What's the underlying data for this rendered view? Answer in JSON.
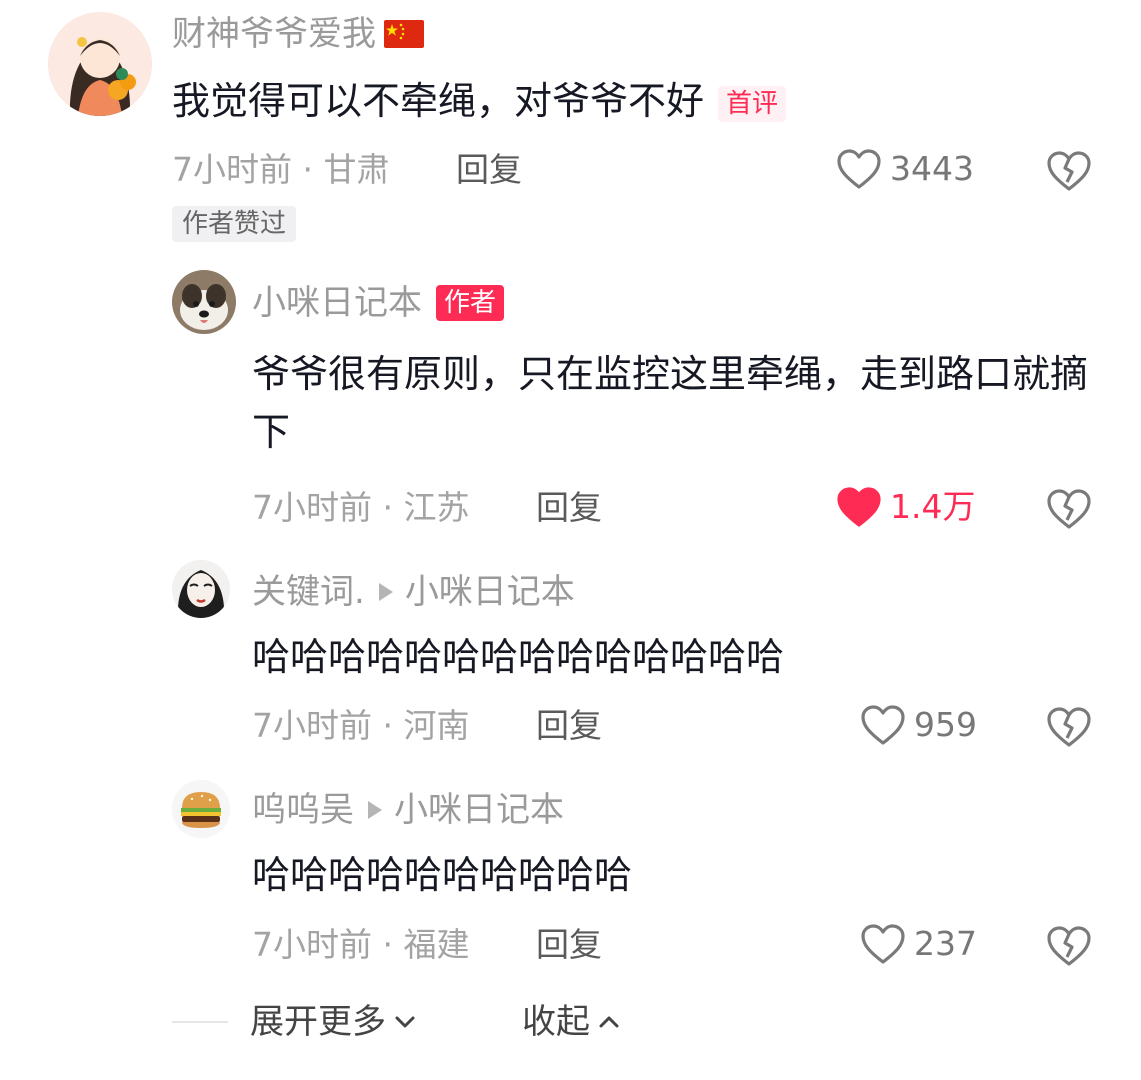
{
  "comments": [
    {
      "username": "财神爷爷爱我",
      "flag_icon": "china-flag-icon",
      "text": "我觉得可以不牵绳，对爷爷不好",
      "tag": "首评",
      "meta": "7小时前 · 甘肃",
      "reply_label": "回复",
      "likes": "3443",
      "liked": false,
      "author_liked_tag": "作者赞过"
    }
  ],
  "replies": [
    {
      "username": "小咪日记本",
      "author_tag": "作者",
      "text": "爷爷很有原则，只在监控这里牵绳，走到路口就摘下",
      "meta": "7小时前 · 江苏",
      "reply_label": "回复",
      "likes": "1.4万",
      "liked": true
    },
    {
      "username": "关键词.",
      "reply_to": "小咪日记本",
      "text": "哈哈哈哈哈哈哈哈哈哈哈哈哈哈",
      "meta": "7小时前 · 河南",
      "reply_label": "回复",
      "likes": "959",
      "liked": false
    },
    {
      "username": "呜呜吴",
      "reply_to": "小咪日记本",
      "text": "哈哈哈哈哈哈哈哈哈哈",
      "meta": "7小时前 · 福建",
      "reply_label": "回复",
      "likes": "237",
      "liked": false
    }
  ],
  "footer": {
    "expand_label": "展开更多",
    "collapse_label": "收起"
  },
  "colors": {
    "accent": "#fe2c55",
    "text": "#161823",
    "muted": "#a3a3a3"
  }
}
